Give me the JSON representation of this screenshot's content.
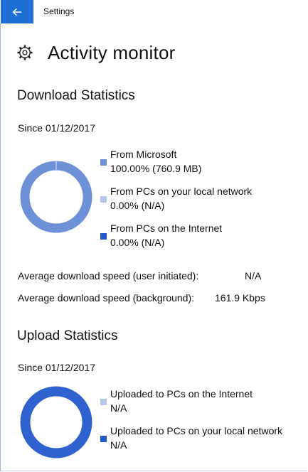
{
  "app": {
    "title": "Settings"
  },
  "page": {
    "title": "Activity monitor"
  },
  "colors": {
    "accent": "#1e6fd6",
    "microsoft": "#6d90d6",
    "local": "#b7c8ec",
    "internet": "#2457c9",
    "upload_ring": "#2d62cf"
  },
  "download": {
    "title": "Download Statistics",
    "since": "Since 01/12/2017",
    "items": [
      {
        "label": "From Microsoft",
        "value": "100.00%  (760.9 MB)",
        "percent": 100
      },
      {
        "label": "From PCs on your local network",
        "value": "0.00%  (N/A)",
        "percent": 0
      },
      {
        "label": "From PCs on the Internet",
        "value": "0.00%  (N/A)",
        "percent": 0
      }
    ],
    "stats": [
      {
        "label": "Average download speed (user initiated):",
        "value": "N/A"
      },
      {
        "label": "Average download speed (background):",
        "value": "161.9 Kbps"
      }
    ]
  },
  "upload": {
    "title": "Upload Statistics",
    "since": "Since 01/12/2017",
    "items": [
      {
        "label": "Uploaded to PCs on the Internet",
        "value": "N/A"
      },
      {
        "label": "Uploaded to PCs on your local network",
        "value": "N/A"
      }
    ]
  }
}
